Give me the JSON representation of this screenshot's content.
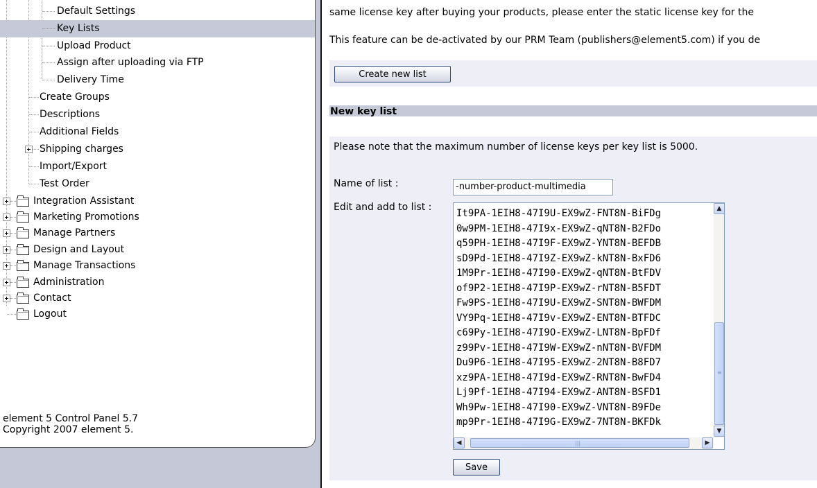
{
  "sidebar": {
    "subitems": [
      "Default Settings",
      "Key Lists",
      "Upload Product",
      "Assign after uploading via FTP",
      "Delivery Time"
    ],
    "items": [
      "Create Groups",
      "Descriptions",
      "Additional Fields",
      "Shipping charges",
      "Import/Export",
      "Test Order"
    ],
    "folders": [
      "Integration Assistant",
      "Marketing Promotions",
      "Manage Partners",
      "Design and Layout",
      "Manage Transactions",
      "Administration",
      "Contact",
      "Logout"
    ],
    "footer_line1": "element 5 Control Panel 5.7",
    "footer_line2": "Copyright 2007 element 5."
  },
  "content": {
    "text_line1": "same license key after buying your products, please enter the static license key for the",
    "text_line2": "This feature can be de-activated by our PRM Team (publishers@element5.com) if you de",
    "create_button": "Create new list",
    "section_title": "New key list",
    "note": "Please note that the maximum number of license keys per key list is 5000.",
    "name_label": "Name of list :",
    "name_value": "-number-product-multimedia",
    "keys_label": "Edit and add to list :",
    "keys": [
      "It9PA-1EIH8-47I9U-EX9wZ-FNT8N-BiFDg",
      "0w9PM-1EIH8-47I9x-EX9wZ-qNT8N-B2FDo",
      "q59PH-1EIH8-47I9F-EX9wZ-YNT8N-BEFDB",
      "sD9Pd-1EIH8-47I9Z-EX9wZ-kNT8N-BxFD6",
      "1M9Pr-1EIH8-47I90-EX9wZ-qNT8N-BtFDV",
      "of9P2-1EIH8-47I9P-EX9wZ-rNT8N-B5FDT",
      "Fw9PS-1EIH8-47I9U-EX9wZ-SNT8N-BWFDM",
      "VY9Pq-1EIH8-47I9v-EX9wZ-ENT8N-BTFDC",
      "c69Py-1EIH8-47I9O-EX9wZ-LNT8N-BpFDf",
      "z99Pv-1EIH8-47I9W-EX9wZ-nNT8N-BVFDM",
      "Du9P6-1EIH8-47I95-EX9wZ-2NT8N-B8FD7",
      "xz9PA-1EIH8-47I9d-EX9wZ-RNT8N-BwFD4",
      "Lj9Pf-1EIH8-47I94-EX9wZ-ANT8N-BSFD1",
      "Wh9Pw-1EIH8-47I90-EX9wZ-VNT8N-B9FDe",
      "mp9Pr-1EIH8-47I9G-EX9wZ-7NT8N-BKFDk"
    ],
    "save_button": "Save"
  }
}
